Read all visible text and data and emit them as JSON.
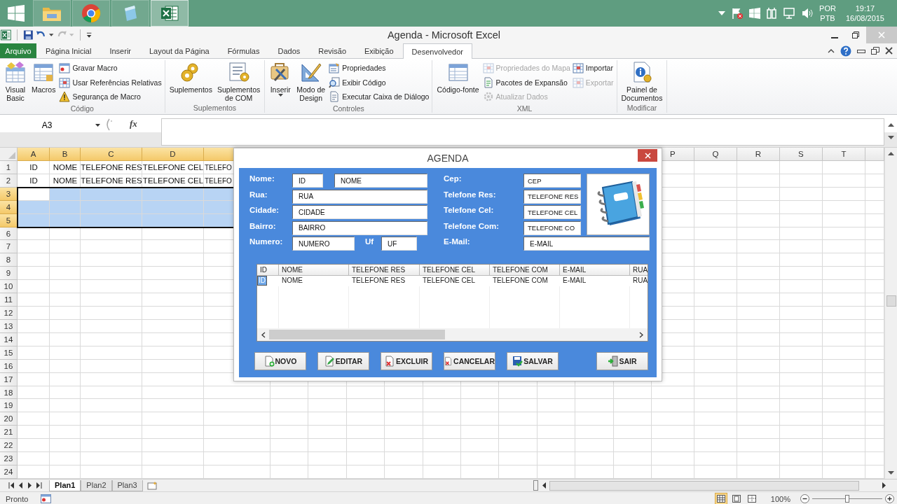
{
  "taskbar": {
    "apps": [
      {
        "kind": "explorer",
        "selected": false
      },
      {
        "kind": "browser",
        "selected": false
      },
      {
        "kind": "notes",
        "selected": false
      },
      {
        "kind": "sheet",
        "selected": true
      }
    ],
    "language": "POR",
    "layout": "PTB",
    "time": "19:17",
    "date": "16/08/2015"
  },
  "window": {
    "title": "Agenda  -  Microsoft Excel"
  },
  "tabs": [
    {
      "label": "Arquivo",
      "kind": "file",
      "selected": false
    },
    {
      "label": "Página Inicial",
      "kind": "tab",
      "selected": false
    },
    {
      "label": "Inserir",
      "kind": "tab",
      "selected": false
    },
    {
      "label": "Layout da Página",
      "kind": "tab",
      "selected": false
    },
    {
      "label": "Fórmulas",
      "kind": "tab",
      "selected": false
    },
    {
      "label": "Dados",
      "kind": "tab",
      "selected": false
    },
    {
      "label": "Revisão",
      "kind": "tab",
      "selected": false
    },
    {
      "label": "Exibição",
      "kind": "tab",
      "selected": false
    },
    {
      "label": "Desenvolvedor",
      "kind": "tab",
      "selected": true
    }
  ],
  "ribbon_groups": [
    {
      "label": "Código",
      "controls": [
        {
          "kind": "large",
          "label": "Visual\nBasic",
          "dropdown": false,
          "disabled": false
        },
        {
          "kind": "large",
          "label": "Macros",
          "dropdown": false,
          "disabled": false
        },
        {
          "kind": "stack",
          "items": [
            {
              "label": "Gravar Macro",
              "disabled": false
            },
            {
              "label": "Usar Referências Relativas",
              "disabled": false
            },
            {
              "label": "Segurança de Macro",
              "disabled": false
            }
          ]
        }
      ]
    },
    {
      "label": "Suplementos",
      "controls": [
        {
          "kind": "large",
          "label": "Suplementos",
          "dropdown": false,
          "disabled": false
        },
        {
          "kind": "large",
          "label": "Suplementos\nde COM",
          "dropdown": false,
          "disabled": false
        }
      ]
    },
    {
      "label": "Controles",
      "controls": [
        {
          "kind": "large",
          "label": "Inserir",
          "dropdown": true,
          "disabled": false
        },
        {
          "kind": "large",
          "label": "Modo de\nDesign",
          "dropdown": false,
          "disabled": false
        },
        {
          "kind": "stack",
          "items": [
            {
              "label": "Propriedades",
              "disabled": false
            },
            {
              "label": "Exibir Código",
              "disabled": false
            },
            {
              "label": "Executar Caixa de Diálogo",
              "disabled": false
            }
          ]
        }
      ]
    },
    {
      "label": "XML",
      "controls": [
        {
          "kind": "large",
          "label": "Código-fonte",
          "dropdown": false,
          "disabled": false
        },
        {
          "kind": "stack",
          "items": [
            {
              "label": "Propriedades do Mapa",
              "disabled": true
            },
            {
              "label": "Pacotes de Expansão",
              "disabled": false
            },
            {
              "label": "Atualizar Dados",
              "disabled": true
            }
          ]
        },
        {
          "kind": "stack",
          "items": [
            {
              "label": "Importar",
              "disabled": false
            },
            {
              "label": "Exportar",
              "disabled": true
            }
          ]
        }
      ]
    },
    {
      "label": "Modificar",
      "controls": [
        {
          "kind": "large",
          "label": "Painel de\nDocumentos",
          "dropdown": false,
          "disabled": false
        }
      ]
    }
  ],
  "formula_bar": {
    "name_box": "A3",
    "function_label": "fx"
  },
  "sheet": {
    "columns": [
      {
        "label": "A",
        "selected": true
      },
      {
        "label": "B",
        "selected": true
      },
      {
        "label": "C",
        "selected": true
      },
      {
        "label": "D",
        "selected": true
      },
      {
        "label": "P",
        "selected": false
      },
      {
        "label": "Q",
        "selected": false
      },
      {
        "label": "R",
        "selected": false
      },
      {
        "label": "S",
        "selected": false
      },
      {
        "label": "T",
        "selected": false
      }
    ],
    "rows": [
      {
        "label": "1",
        "selected": false,
        "cells": [
          "ID",
          "NOME",
          "TELEFONE RES",
          "TELEFONE CEL",
          "TELEFO"
        ]
      },
      {
        "label": "2",
        "selected": false,
        "cells": [
          "ID",
          "NOME",
          "TELEFONE RES",
          "TELEFONE CEL",
          "TELEFO"
        ]
      },
      {
        "label": "3",
        "selected": true
      },
      {
        "label": "4",
        "selected": true
      },
      {
        "label": "5",
        "selected": true
      },
      {
        "label": "6",
        "selected": false
      },
      {
        "label": "7",
        "selected": false
      },
      {
        "label": "8",
        "selected": false
      },
      {
        "label": "9",
        "selected": false
      },
      {
        "label": "10",
        "selected": false
      },
      {
        "label": "11",
        "selected": false
      },
      {
        "label": "12",
        "selected": false
      },
      {
        "label": "13",
        "selected": false
      },
      {
        "label": "14",
        "selected": false
      },
      {
        "label": "15",
        "selected": false
      },
      {
        "label": "16",
        "selected": false
      },
      {
        "label": "17",
        "selected": false
      },
      {
        "label": "18",
        "selected": false
      },
      {
        "label": "19",
        "selected": false
      },
      {
        "label": "20",
        "selected": false
      },
      {
        "label": "21",
        "selected": false
      },
      {
        "label": "22",
        "selected": false
      },
      {
        "label": "23",
        "selected": false
      },
      {
        "label": "24",
        "selected": false
      }
    ]
  },
  "dialog": {
    "title": "AGENDA",
    "left_rows": [
      {
        "label": "Nome:",
        "fields": [
          "ID",
          "NOME"
        ]
      },
      {
        "label": "Rua:",
        "fields": [
          "RUA"
        ]
      },
      {
        "label": "Cidade:",
        "fields": [
          "CIDADE"
        ]
      },
      {
        "label": "Bairro:",
        "fields": [
          "BAIRRO"
        ]
      },
      {
        "label": "Numero:",
        "fields": [
          "NUMERO"
        ],
        "suffix_label": "Uf",
        "suffix_field": "UF"
      }
    ],
    "right_rows": [
      {
        "label": "Cep:",
        "field": "CEP",
        "kind": "narrow"
      },
      {
        "label": "Telefone Res:",
        "field": "TELEFONE RES",
        "kind": "narrow"
      },
      {
        "label": "Telefone Cel:",
        "field": "TELEFONE CEL",
        "kind": "narrow"
      },
      {
        "label": "Telefone Com:",
        "field": "TELEFONE CO",
        "kind": "narrow"
      },
      {
        "label": "E-Mail:",
        "field": "E-MAIL",
        "kind": "wide"
      }
    ],
    "list": {
      "columns": [
        "ID",
        "NOME",
        "TELEFONE RES",
        "TELEFONE CEL",
        "TELEFONE COM",
        "E-MAIL",
        "RUA"
      ],
      "rows": [
        {
          "selected": true,
          "cells": [
            "ID",
            "NOME",
            "TELEFONE RES",
            "TELEFONE CEL",
            "TELEFONE COM",
            "E-MAIL",
            "RUA"
          ]
        }
      ]
    },
    "buttons": [
      {
        "label": "NOVO",
        "kind": "action"
      },
      {
        "label": "EDITAR",
        "kind": "action"
      },
      {
        "label": "EXCLUIR",
        "kind": "action"
      },
      {
        "label": "CANCELAR",
        "kind": "action"
      },
      {
        "label": "SALVAR",
        "kind": "action"
      },
      {
        "label": "SAIR",
        "kind": "exit"
      }
    ]
  },
  "sheet_tabs": [
    {
      "label": "Plan1",
      "selected": true
    },
    {
      "label": "Plan2",
      "selected": false
    },
    {
      "label": "Plan3",
      "selected": false
    }
  ],
  "status_bar": {
    "text": "Pronto",
    "views": [
      {
        "selected": true
      },
      {
        "selected": false
      },
      {
        "selected": false
      }
    ],
    "zoom": "100%",
    "zoom_slider": {
      "level": 0.5
    }
  }
}
